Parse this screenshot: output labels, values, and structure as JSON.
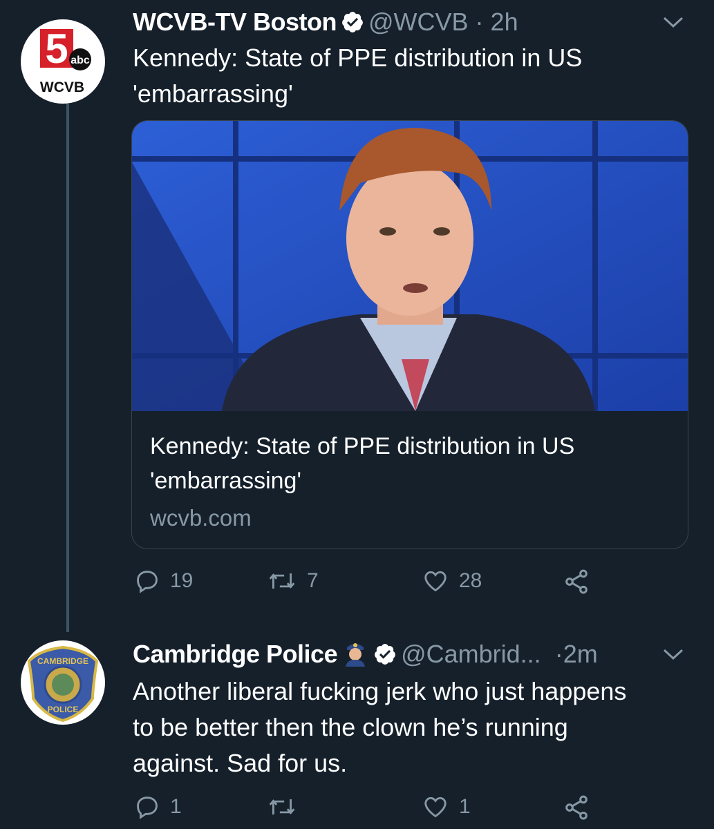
{
  "tweet1": {
    "display_name": "WCVB-TV Boston",
    "handle": "@WCVB",
    "separator": "·",
    "time": "2h",
    "text_line1": "Kennedy: State of PPE distribution in US",
    "text_line2": "'embarrassing'",
    "avatar": {
      "logo_number": "5",
      "logo_network": "abc",
      "logo_label": "WCVB"
    },
    "card": {
      "title_line1": "Kennedy: State of PPE distribution in US",
      "title_line2": "'embarrassing'",
      "domain": "wcvb.com"
    },
    "replies": "19",
    "retweets": "7",
    "likes": "28"
  },
  "tweet2": {
    "display_name": "Cambridge Police",
    "handle": "@Cambrid...",
    "separator": "·",
    "time": "2m",
    "text_line1": "Another liberal fucking jerk who just happens",
    "text_line2": "to be better then the clown he’s running",
    "text_line3": "against. Sad for us.",
    "avatar": {
      "badge_top": "CAMBRIDGE",
      "badge_bottom": "POLICE"
    },
    "replies": "1",
    "retweets": "",
    "likes": "1"
  },
  "icons": [
    "verified-icon",
    "caret-down-icon",
    "reply-icon",
    "retweet-icon",
    "like-icon",
    "share-icon",
    "police-officer-emoji-icon"
  ],
  "colors": {
    "background": "#15202b",
    "muted": "#8899a6",
    "border": "#38444d",
    "verified": "#ffffff"
  }
}
